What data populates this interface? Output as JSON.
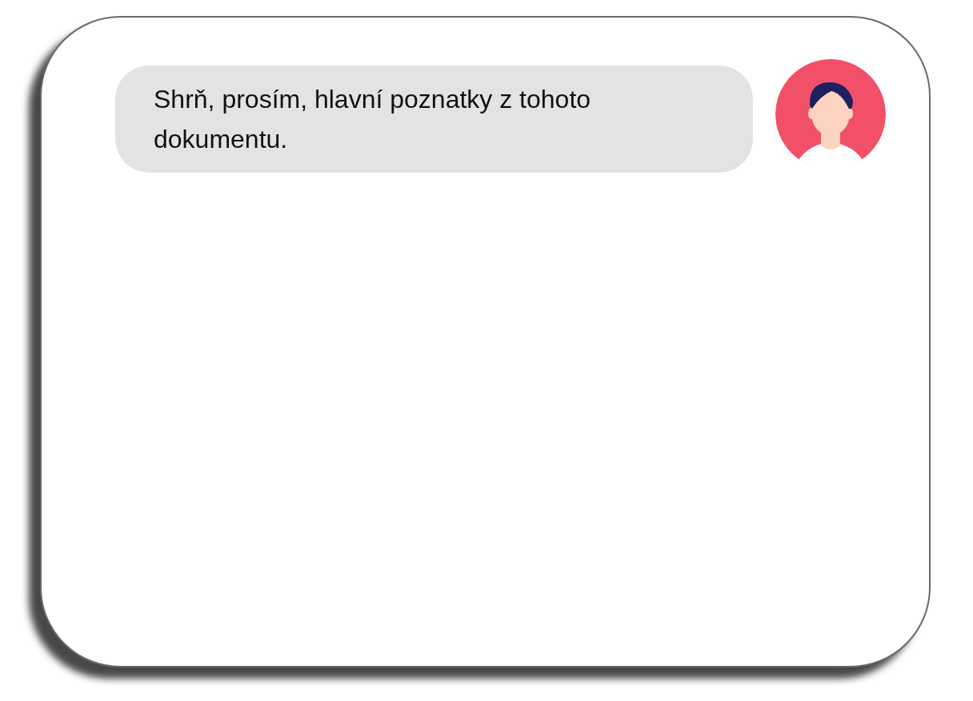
{
  "messages": [
    {
      "kind": "user",
      "text": "Shrň, prosím, hlavní poznatky z tohoto dokumentu."
    }
  ]
}
